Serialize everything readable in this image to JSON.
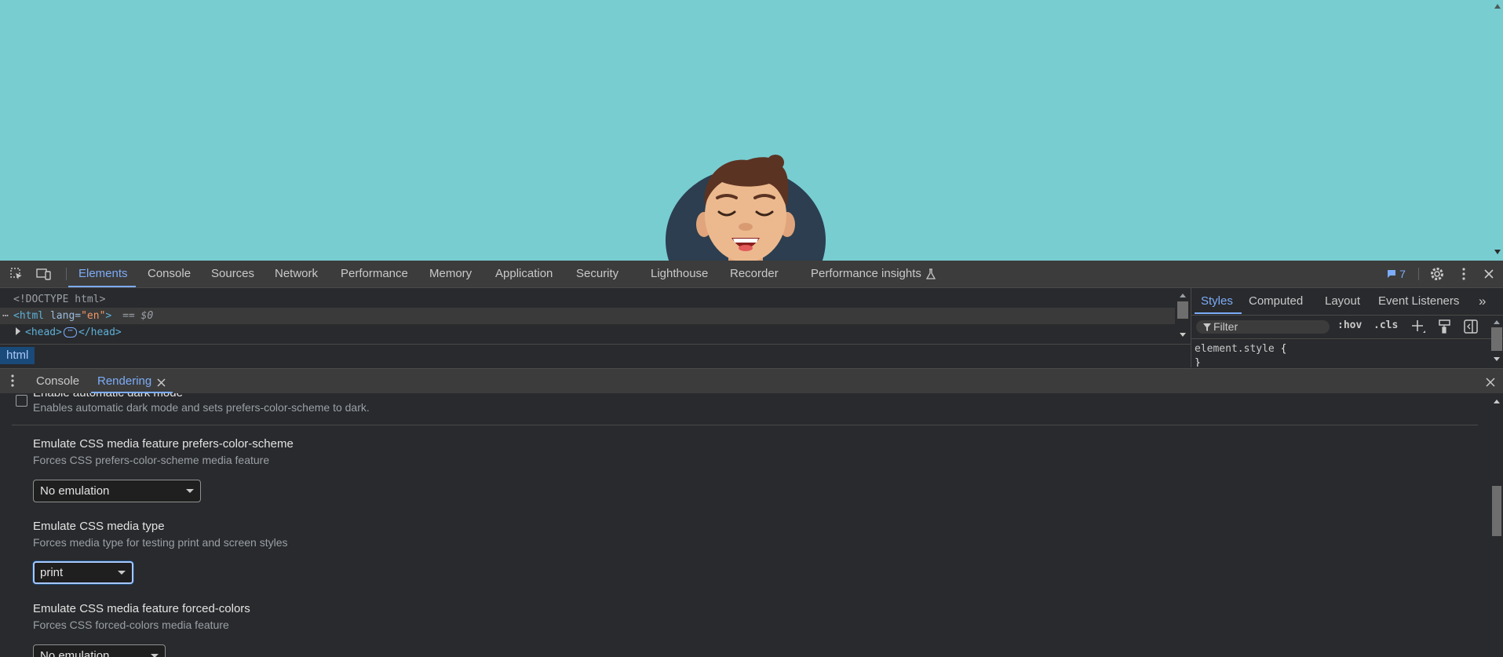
{
  "toolbar": {
    "tabs": [
      "Elements",
      "Console",
      "Sources",
      "Network",
      "Performance",
      "Memory",
      "Application",
      "Security",
      "Lighthouse",
      "Recorder",
      "Performance insights"
    ],
    "issues_count": "7"
  },
  "elements": {
    "doctype": "<!DOCTYPE html>",
    "html_tag_open": "<html",
    "html_attr": "lang",
    "html_attr_value": "\"en\"",
    "html_tag_close": ">",
    "selected_marker": "== $0",
    "head_open": "<head>",
    "head_close": "</head>"
  },
  "breadcrumb": {
    "item": "html"
  },
  "styles": {
    "tabs": [
      "Styles",
      "Computed",
      "Layout",
      "Event Listeners"
    ],
    "filter_placeholder": "Filter",
    "hov": ":hov",
    "cls": ".cls",
    "selector": "element.style",
    "brace_open": "{",
    "brace_close": "}"
  },
  "drawer": {
    "tabs": [
      "Console",
      "Rendering"
    ]
  },
  "rendering": {
    "dark_mode_title": "Enable automatic dark mode",
    "dark_mode_desc": "Enables automatic dark mode and sets prefers-color-scheme to dark.",
    "color_scheme_title": "Emulate CSS media feature prefers-color-scheme",
    "color_scheme_desc": "Forces CSS prefers-color-scheme media feature",
    "color_scheme_value": "No emulation",
    "media_type_title": "Emulate CSS media type",
    "media_type_desc": "Forces media type for testing print and screen styles",
    "media_type_value": "print",
    "forced_colors_title": "Emulate CSS media feature forced-colors",
    "forced_colors_desc": "Forces CSS forced-colors media feature",
    "forced_colors_value": "No emulation"
  }
}
